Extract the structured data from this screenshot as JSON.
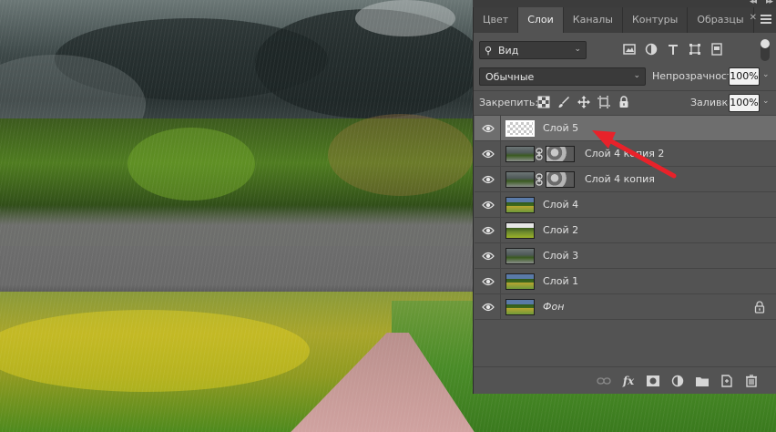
{
  "panel": {
    "tabs": [
      {
        "label": "Цвет",
        "active": false
      },
      {
        "label": "Слои",
        "active": true
      },
      {
        "label": "Каналы",
        "active": false
      },
      {
        "label": "Контуры",
        "active": false
      },
      {
        "label": "Образцы",
        "active": false
      }
    ],
    "filter": {
      "kind_label": "Вид"
    },
    "blend_mode": "Обычные",
    "opacity": {
      "label": "Непрозрачность:",
      "value": "100%"
    },
    "lock": {
      "label": "Закрепить:"
    },
    "fill": {
      "label": "Заливка:",
      "value": "100%"
    },
    "layers": [
      {
        "name": "Слой 5",
        "selected": true
      },
      {
        "name": "Слой 4 копия 2",
        "selected": false
      },
      {
        "name": "Слой 4 копия",
        "selected": false
      },
      {
        "name": "Слой 4",
        "selected": false
      },
      {
        "name": "Слой 2",
        "selected": false
      },
      {
        "name": "Слой 3",
        "selected": false
      },
      {
        "name": "Слой 1",
        "selected": false
      },
      {
        "name": "Фон",
        "selected": false,
        "locked": true
      }
    ]
  },
  "annotation": {
    "arrow_color": "#e8222a"
  }
}
